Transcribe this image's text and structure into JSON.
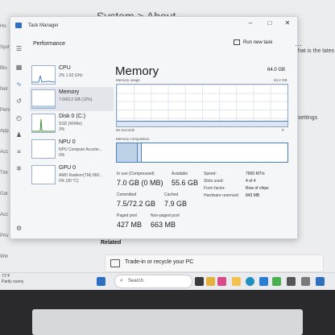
{
  "background": {
    "settings_title": "System  >  About",
    "sidebar_items": [
      "Ho",
      "Syst",
      "Blu",
      "Net",
      "Pers",
      "App",
      "Acc",
      "Tim",
      "Gar",
      "Acc",
      "Priv",
      "Win"
    ],
    "right_text_1": "that is the lates",
    "right_text_2": "settings",
    "related_label": "Related",
    "trade_in_label": "Trade-in or recycle your PC",
    "weather_temp": "71°F",
    "weather_desc": "Partly sunny"
  },
  "task_manager": {
    "title": "Task Manager",
    "section_title": "Performance",
    "run_new_task": "Run new task",
    "more_icon": "ellipsis-icon",
    "window_controls": [
      "–",
      "□",
      "✕"
    ],
    "devices": [
      {
        "name": "CPU",
        "sub": "2%  1.92 GHz",
        "sub2": ""
      },
      {
        "name": "Memory",
        "sub": "7.6/63.2 GB (12%)",
        "sub2": ""
      },
      {
        "name": "Disk 0 (C:)",
        "sub": "SSD (NVMe)",
        "sub2": "3%"
      },
      {
        "name": "NPU 0",
        "sub": "NPU Compute Acceler...",
        "sub2": "0%"
      },
      {
        "name": "GPU 0",
        "sub": "AMD Radeon(TM) 860...",
        "sub2": "0% (30 °C)"
      }
    ],
    "memory": {
      "title": "Memory",
      "total": "64.0 GB",
      "usage_label": "Memory usage",
      "usage_max": "63.2 GB",
      "usage_fraction": 0.12,
      "seconds_label": "60 seconds",
      "zero_label": "0",
      "composition_label": "Memory composition",
      "composition_in_use_fraction": 0.12,
      "composition_modified_fraction": 0.02,
      "composition_standby_fraction": 0.12,
      "stats": {
        "in_use_label": "In use (Compressed)",
        "in_use_value": "7.0 GB (0 MB)",
        "available_label": "Available",
        "available_value": "55.6 GB",
        "committed_label": "Committed",
        "committed_value": "7.5/72.2 GB",
        "cached_label": "Cached",
        "cached_value": "7.9 GB",
        "paged_label": "Paged pool",
        "paged_value": "427 MB",
        "nonpaged_label": "Non-paged pool",
        "nonpaged_value": "663 MB"
      },
      "specs": [
        {
          "label": "Speed:",
          "value": "7500 MT/s"
        },
        {
          "label": "Slots used:",
          "value": "4 of 4"
        },
        {
          "label": "Form factor:",
          "value": "Row of chips"
        },
        {
          "label": "Hardware reserved:",
          "value": "843 MB"
        }
      ]
    }
  },
  "taskbar": {
    "search_placeholder": "Search",
    "colors": {
      "start": "#2f6fbf",
      "accent": "#4a7fbf"
    }
  }
}
